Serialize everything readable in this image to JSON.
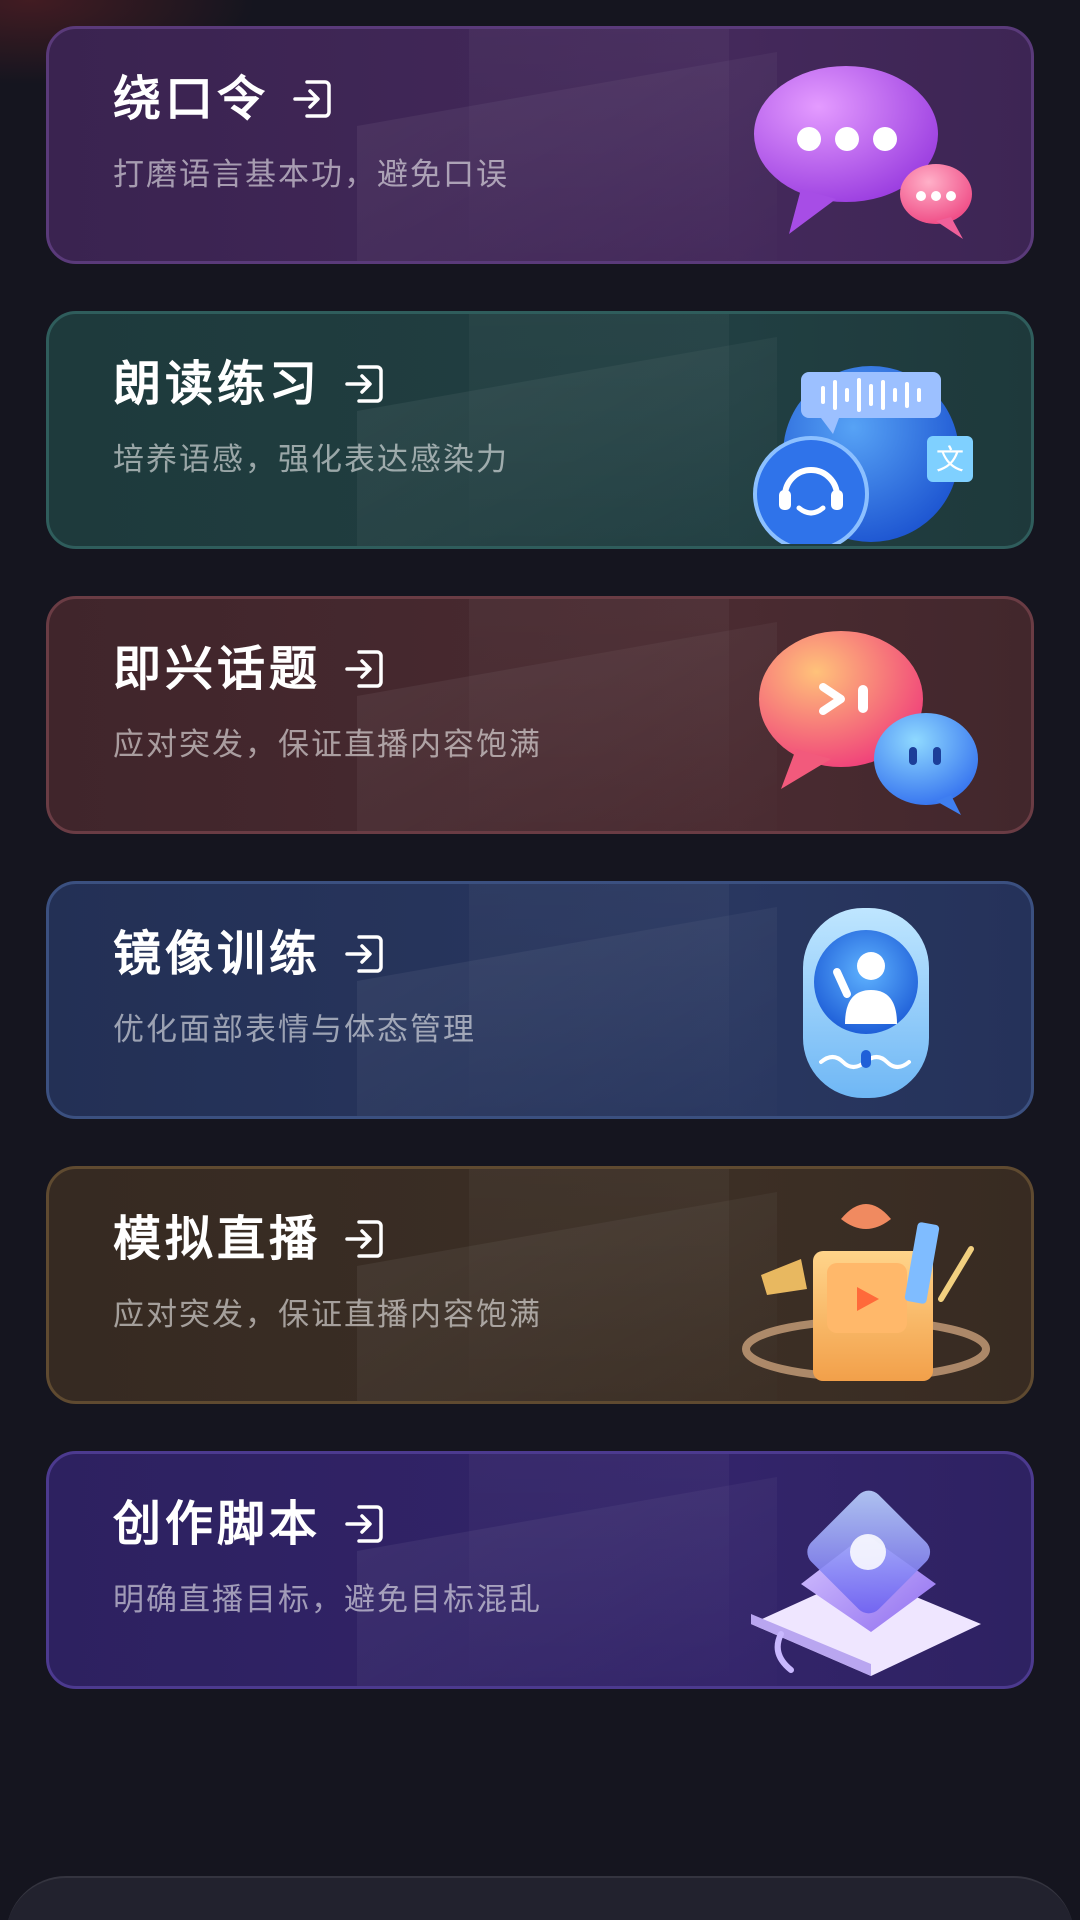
{
  "cards": [
    {
      "title": "绕口令",
      "subtitle": "打磨语言基本功，避免口误",
      "icon": "speech-bubbles-icon",
      "accent": "#44295b"
    },
    {
      "title": "朗读练习",
      "subtitle": "培养语感，强化表达感染力",
      "icon": "headset-voice-icon",
      "accent": "#213f42"
    },
    {
      "title": "即兴话题",
      "subtitle": "应对突发，保证直播内容饱满",
      "icon": "chat-bubbles-icon",
      "accent": "#4a2b31"
    },
    {
      "title": "镜像训练",
      "subtitle": "优化面部表情与体态管理",
      "icon": "mirror-person-icon",
      "accent": "#293760"
    },
    {
      "title": "模拟直播",
      "subtitle": "应对突发，保证直播内容饱满",
      "icon": "gift-box-icon",
      "accent": "#3c2f25"
    },
    {
      "title": "创作脚本",
      "subtitle": "明确直播目标，避免目标混乱",
      "icon": "script-book-icon",
      "accent": "#33246a"
    }
  ]
}
